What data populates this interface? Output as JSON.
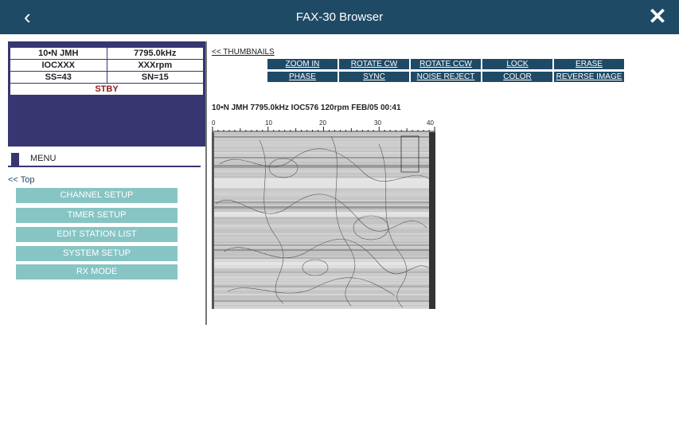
{
  "titlebar": {
    "title": "FAX-30 Browser",
    "back_icon": "‹",
    "close_icon": "✕"
  },
  "status": {
    "rows": [
      [
        "10•N JMH",
        "7795.0kHz"
      ],
      [
        "IOCXXX",
        "XXXrpm"
      ],
      [
        "SS=43",
        "SN=15"
      ]
    ],
    "state": "STBY"
  },
  "menu": {
    "header": "MENU",
    "top_link": "<< Top",
    "items": [
      "CHANNEL SETUP",
      "TIMER SETUP",
      "EDIT STATION LIST",
      "SYSTEM SETUP",
      "RX MODE"
    ]
  },
  "viewer": {
    "thumbnails_link": "<< THUMBNAILS",
    "buttons_row1": [
      "ZOOM IN",
      "ROTATE CW",
      "ROTATE CCW",
      "LOCK",
      "ERASE"
    ],
    "buttons_row2": [
      "PHASE",
      "SYNC",
      "NOISE REJECT",
      "COLOR",
      "REVERSE IMAGE"
    ],
    "fax_title": "10•N JMH 7795.0kHz IOC576 120rpm FEB/05 00:41",
    "scale_labels": [
      "0",
      "10",
      "20",
      "30",
      "40"
    ]
  }
}
